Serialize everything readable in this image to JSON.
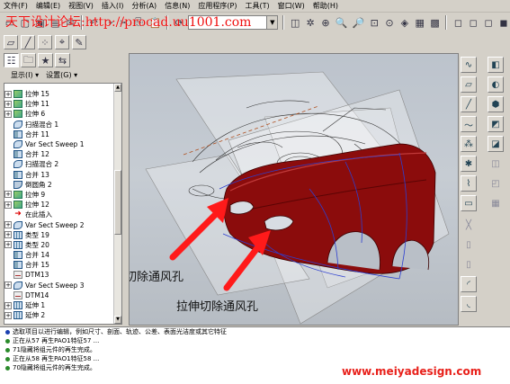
{
  "menubar": {
    "items": [
      "文件(F)",
      "编辑(E)",
      "视图(V)",
      "插入(I)",
      "分析(A)",
      "信息(N)",
      "应用程序(P)",
      "工具(T)",
      "窗口(W)",
      "帮助(H)"
    ]
  },
  "watermark_top": "天下设计论坛:http://procad.uu1001.com",
  "navigator": {
    "display_label": "显示(I) ▾",
    "settings_label": "设置(G) ▾"
  },
  "model_tree": {
    "items": [
      {
        "label": "拉伸 15",
        "icon": "extrude-icon",
        "expandable": true
      },
      {
        "label": "拉伸 11",
        "icon": "extrude-icon",
        "expandable": true
      },
      {
        "label": "拉伸 6",
        "icon": "extrude-icon",
        "expandable": true
      },
      {
        "label": "扫描混合 1",
        "icon": "sweep-icon",
        "expandable": false
      },
      {
        "label": "合并 11",
        "icon": "merge-icon",
        "expandable": false
      },
      {
        "label": "Var Sect Sweep 1",
        "icon": "sweep-icon",
        "expandable": false
      },
      {
        "label": "合并 12",
        "icon": "merge-icon",
        "expandable": false
      },
      {
        "label": "扫描混合 2",
        "icon": "sweep-icon",
        "expandable": false
      },
      {
        "label": "合并 13",
        "icon": "merge-icon",
        "expandable": false
      },
      {
        "label": "倒圆角 2",
        "icon": "round-icon",
        "expandable": false
      },
      {
        "label": "拉伸 9",
        "icon": "extrude-icon",
        "expandable": true
      },
      {
        "label": "拉伸 12",
        "icon": "extrude-icon",
        "expandable": true
      },
      {
        "label": "在此插入",
        "icon": "insert-here-icon",
        "expandable": false
      },
      {
        "label": "Var Sect Sweep 2",
        "icon": "sweep-icon",
        "expandable": true
      },
      {
        "label": "类型 19",
        "icon": "pattern-icon",
        "expandable": true
      },
      {
        "label": "类型 20",
        "icon": "pattern-icon",
        "expandable": true
      },
      {
        "label": "合并 14",
        "icon": "merge-icon",
        "expandable": false
      },
      {
        "label": "合并 15",
        "icon": "merge-icon",
        "expandable": false
      },
      {
        "label": "DTM13",
        "icon": "datum-plane-icon",
        "expandable": false
      },
      {
        "label": "Var Sect Sweep 3",
        "icon": "sweep-icon",
        "expandable": true
      },
      {
        "label": "DTM14",
        "icon": "datum-plane-icon",
        "expandable": false
      },
      {
        "label": "延伸 1",
        "icon": "extend-icon",
        "expandable": true
      },
      {
        "label": "延伸 2",
        "icon": "extend-icon",
        "expandable": true
      }
    ]
  },
  "viewport": {
    "annotations": [
      "拉伸切除通风孔",
      "拉伸切除通风孔"
    ],
    "model_color": "#8b0c0c",
    "arrow_color": "#ff1a1a"
  },
  "messages": [
    {
      "text": "选取项目以进行编辑，例如尺寸、剖面、轨迹、公差、表面光洁度或其它特征",
      "kind": "prompt"
    },
    {
      "text": "正在从57 再生PAO1特征57 ...",
      "kind": "info"
    },
    {
      "text": "71隐藏将组元件的再生完成。",
      "kind": "info"
    },
    {
      "text": "正在从58 再生PAO1特征58 ...",
      "kind": "info"
    },
    {
      "text": "70隐藏将组元件的再生完成。",
      "kind": "info"
    }
  ],
  "watermark_bottom": "www.meiyadesign.com"
}
